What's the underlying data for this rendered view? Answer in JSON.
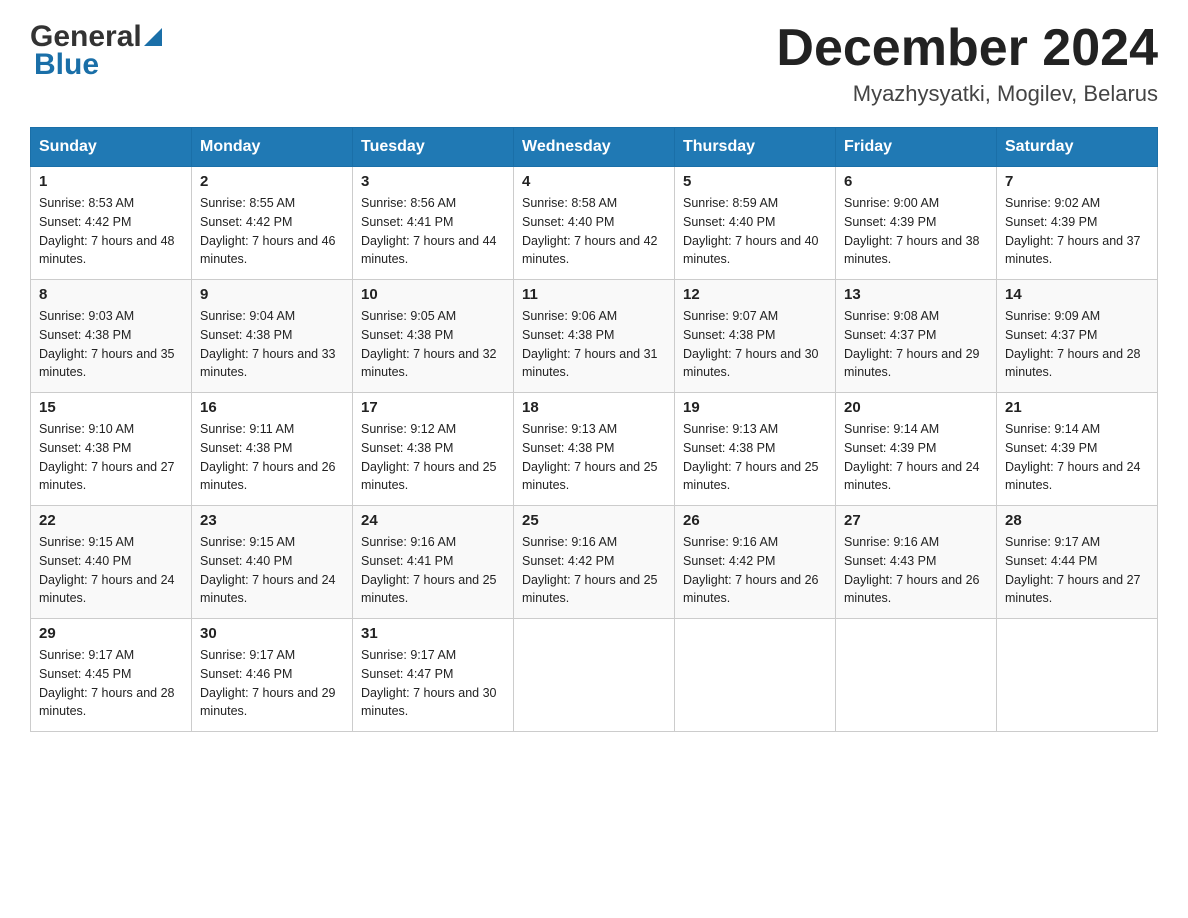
{
  "header": {
    "logo_line1": "General",
    "logo_line2": "Blue",
    "month": "December 2024",
    "location": "Myazhysyatki, Mogilev, Belarus"
  },
  "weekdays": [
    "Sunday",
    "Monday",
    "Tuesday",
    "Wednesday",
    "Thursday",
    "Friday",
    "Saturday"
  ],
  "weeks": [
    [
      {
        "day": "1",
        "sunrise": "Sunrise: 8:53 AM",
        "sunset": "Sunset: 4:42 PM",
        "daylight": "Daylight: 7 hours and 48 minutes."
      },
      {
        "day": "2",
        "sunrise": "Sunrise: 8:55 AM",
        "sunset": "Sunset: 4:42 PM",
        "daylight": "Daylight: 7 hours and 46 minutes."
      },
      {
        "day": "3",
        "sunrise": "Sunrise: 8:56 AM",
        "sunset": "Sunset: 4:41 PM",
        "daylight": "Daylight: 7 hours and 44 minutes."
      },
      {
        "day": "4",
        "sunrise": "Sunrise: 8:58 AM",
        "sunset": "Sunset: 4:40 PM",
        "daylight": "Daylight: 7 hours and 42 minutes."
      },
      {
        "day": "5",
        "sunrise": "Sunrise: 8:59 AM",
        "sunset": "Sunset: 4:40 PM",
        "daylight": "Daylight: 7 hours and 40 minutes."
      },
      {
        "day": "6",
        "sunrise": "Sunrise: 9:00 AM",
        "sunset": "Sunset: 4:39 PM",
        "daylight": "Daylight: 7 hours and 38 minutes."
      },
      {
        "day": "7",
        "sunrise": "Sunrise: 9:02 AM",
        "sunset": "Sunset: 4:39 PM",
        "daylight": "Daylight: 7 hours and 37 minutes."
      }
    ],
    [
      {
        "day": "8",
        "sunrise": "Sunrise: 9:03 AM",
        "sunset": "Sunset: 4:38 PM",
        "daylight": "Daylight: 7 hours and 35 minutes."
      },
      {
        "day": "9",
        "sunrise": "Sunrise: 9:04 AM",
        "sunset": "Sunset: 4:38 PM",
        "daylight": "Daylight: 7 hours and 33 minutes."
      },
      {
        "day": "10",
        "sunrise": "Sunrise: 9:05 AM",
        "sunset": "Sunset: 4:38 PM",
        "daylight": "Daylight: 7 hours and 32 minutes."
      },
      {
        "day": "11",
        "sunrise": "Sunrise: 9:06 AM",
        "sunset": "Sunset: 4:38 PM",
        "daylight": "Daylight: 7 hours and 31 minutes."
      },
      {
        "day": "12",
        "sunrise": "Sunrise: 9:07 AM",
        "sunset": "Sunset: 4:38 PM",
        "daylight": "Daylight: 7 hours and 30 minutes."
      },
      {
        "day": "13",
        "sunrise": "Sunrise: 9:08 AM",
        "sunset": "Sunset: 4:37 PM",
        "daylight": "Daylight: 7 hours and 29 minutes."
      },
      {
        "day": "14",
        "sunrise": "Sunrise: 9:09 AM",
        "sunset": "Sunset: 4:37 PM",
        "daylight": "Daylight: 7 hours and 28 minutes."
      }
    ],
    [
      {
        "day": "15",
        "sunrise": "Sunrise: 9:10 AM",
        "sunset": "Sunset: 4:38 PM",
        "daylight": "Daylight: 7 hours and 27 minutes."
      },
      {
        "day": "16",
        "sunrise": "Sunrise: 9:11 AM",
        "sunset": "Sunset: 4:38 PM",
        "daylight": "Daylight: 7 hours and 26 minutes."
      },
      {
        "day": "17",
        "sunrise": "Sunrise: 9:12 AM",
        "sunset": "Sunset: 4:38 PM",
        "daylight": "Daylight: 7 hours and 25 minutes."
      },
      {
        "day": "18",
        "sunrise": "Sunrise: 9:13 AM",
        "sunset": "Sunset: 4:38 PM",
        "daylight": "Daylight: 7 hours and 25 minutes."
      },
      {
        "day": "19",
        "sunrise": "Sunrise: 9:13 AM",
        "sunset": "Sunset: 4:38 PM",
        "daylight": "Daylight: 7 hours and 25 minutes."
      },
      {
        "day": "20",
        "sunrise": "Sunrise: 9:14 AM",
        "sunset": "Sunset: 4:39 PM",
        "daylight": "Daylight: 7 hours and 24 minutes."
      },
      {
        "day": "21",
        "sunrise": "Sunrise: 9:14 AM",
        "sunset": "Sunset: 4:39 PM",
        "daylight": "Daylight: 7 hours and 24 minutes."
      }
    ],
    [
      {
        "day": "22",
        "sunrise": "Sunrise: 9:15 AM",
        "sunset": "Sunset: 4:40 PM",
        "daylight": "Daylight: 7 hours and 24 minutes."
      },
      {
        "day": "23",
        "sunrise": "Sunrise: 9:15 AM",
        "sunset": "Sunset: 4:40 PM",
        "daylight": "Daylight: 7 hours and 24 minutes."
      },
      {
        "day": "24",
        "sunrise": "Sunrise: 9:16 AM",
        "sunset": "Sunset: 4:41 PM",
        "daylight": "Daylight: 7 hours and 25 minutes."
      },
      {
        "day": "25",
        "sunrise": "Sunrise: 9:16 AM",
        "sunset": "Sunset: 4:42 PM",
        "daylight": "Daylight: 7 hours and 25 minutes."
      },
      {
        "day": "26",
        "sunrise": "Sunrise: 9:16 AM",
        "sunset": "Sunset: 4:42 PM",
        "daylight": "Daylight: 7 hours and 26 minutes."
      },
      {
        "day": "27",
        "sunrise": "Sunrise: 9:16 AM",
        "sunset": "Sunset: 4:43 PM",
        "daylight": "Daylight: 7 hours and 26 minutes."
      },
      {
        "day": "28",
        "sunrise": "Sunrise: 9:17 AM",
        "sunset": "Sunset: 4:44 PM",
        "daylight": "Daylight: 7 hours and 27 minutes."
      }
    ],
    [
      {
        "day": "29",
        "sunrise": "Sunrise: 9:17 AM",
        "sunset": "Sunset: 4:45 PM",
        "daylight": "Daylight: 7 hours and 28 minutes."
      },
      {
        "day": "30",
        "sunrise": "Sunrise: 9:17 AM",
        "sunset": "Sunset: 4:46 PM",
        "daylight": "Daylight: 7 hours and 29 minutes."
      },
      {
        "day": "31",
        "sunrise": "Sunrise: 9:17 AM",
        "sunset": "Sunset: 4:47 PM",
        "daylight": "Daylight: 7 hours and 30 minutes."
      },
      null,
      null,
      null,
      null
    ]
  ]
}
